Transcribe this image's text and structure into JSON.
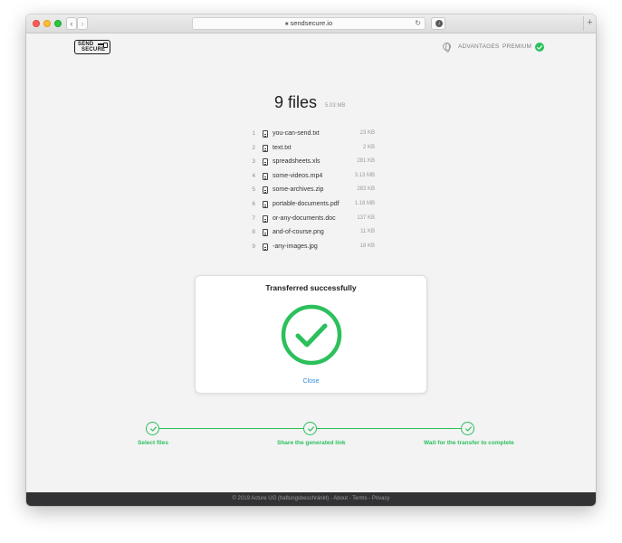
{
  "browser": {
    "url": "sendsecure.io",
    "back_glyph": "‹",
    "forward_glyph": "›",
    "reload_glyph": "↻",
    "new_tab_glyph": "+"
  },
  "header": {
    "logo_line1": "SEND",
    "logo_line2": "SECURE",
    "nav": [
      "ADVANTAGES",
      "PREMIUM"
    ],
    "status_color": "#2cc05c"
  },
  "files": {
    "title": "9 files",
    "total_size": "5.03 MB",
    "items": [
      {
        "num": "1",
        "name": "you-can-send.txt",
        "size": "23 KB"
      },
      {
        "num": "2",
        "name": "text.txt",
        "size": "2 KB"
      },
      {
        "num": "3",
        "name": "spreadsheets.xls",
        "size": "281 KB"
      },
      {
        "num": "4",
        "name": "some-videos.mp4",
        "size": "3.13 MB"
      },
      {
        "num": "5",
        "name": "some-archives.zip",
        "size": "283 KB"
      },
      {
        "num": "6",
        "name": "portable-documents.pdf",
        "size": "1.18 MB"
      },
      {
        "num": "7",
        "name": "or-any-documents.doc",
        "size": "137 KB"
      },
      {
        "num": "8",
        "name": "and-of-course.png",
        "size": "11 KB"
      },
      {
        "num": "9",
        "name": "-any-images.jpg",
        "size": "18 KB"
      }
    ]
  },
  "dialog": {
    "title": "Transferred successfully",
    "close_label": "Close",
    "accent": "#2cc05c",
    "link_color": "#2f8de0"
  },
  "steps": [
    {
      "label": "Select files"
    },
    {
      "label": "Share the generated link"
    },
    {
      "label": "Wait for the transfer to complete"
    }
  ],
  "footer": {
    "text": "© 2019 Acture UG (haftungsbeschränkt) - About - Terms - Privacy"
  }
}
